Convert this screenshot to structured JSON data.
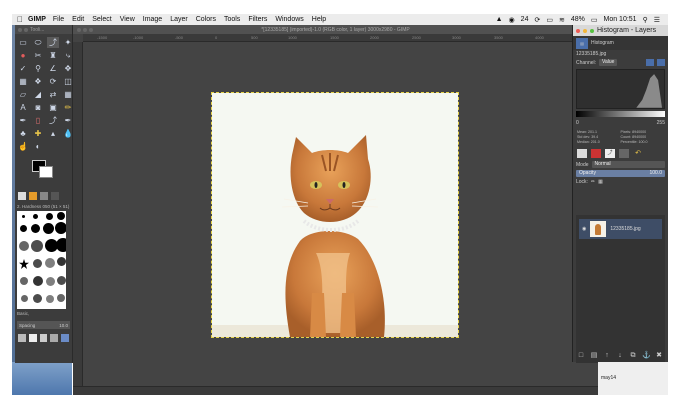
{
  "menubar": {
    "app_name": "GIMP",
    "items": [
      "File",
      "Edit",
      "Select",
      "View",
      "Image",
      "Layer",
      "Colors",
      "Tools",
      "Filters",
      "Windows",
      "Help"
    ],
    "battery_percent": "48%",
    "clock": "Mon 10:51",
    "status_24": "24"
  },
  "toolbox": {
    "title": "Tooli...",
    "brush_label": "2. Hardness 050 (51 × 51)",
    "preset": "Basic,",
    "spacing_label": "Spacing",
    "spacing_value": "10.0"
  },
  "image_window": {
    "title": "*[12335185] (imported)-1.0 (RGB color, 1 layer) 3000x2980 - GIMP",
    "ruler_marks": [
      "-1500",
      "-1000",
      "-500",
      "0",
      "500",
      "1000",
      "1500",
      "2000",
      "2500",
      "3000",
      "3500",
      "4000"
    ]
  },
  "dock": {
    "title": "Histogram - Layers",
    "tab_label": "Histogram",
    "file_label": "12335185.jpg",
    "channel_label": "Channel:",
    "channel_value": "Value",
    "range_min": "0",
    "range_max": "255",
    "stats": [
      {
        "label": "Mean:",
        "value": "201.1"
      },
      {
        "label": "Pixels:",
        "value": "8940000"
      },
      {
        "label": "Std dev:",
        "value": "39.4"
      },
      {
        "label": "Count:",
        "value": "8940000"
      },
      {
        "label": "Median:",
        "value": "201.0"
      },
      {
        "label": "Percentile:",
        "value": "100.0"
      }
    ],
    "mode_label": "Mode",
    "mode_value": "Normal",
    "opacity_label": "Opacity",
    "opacity_value": "100.0",
    "lock_label": "Lock:",
    "layer_name": "12335185.jpg"
  },
  "footer": {
    "text": "may14"
  }
}
